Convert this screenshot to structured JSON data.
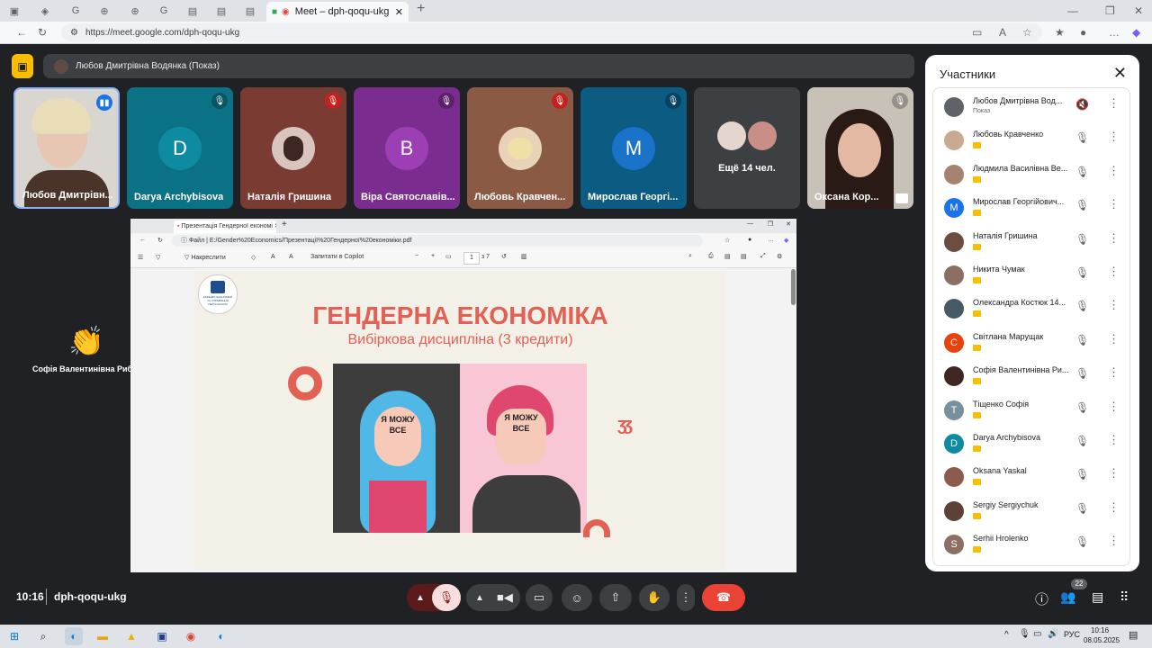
{
  "browser": {
    "active_tab_title": "Meet – dph-qoqu-ukg",
    "url": "https://meet.google.com/dph-qoqu-ukg"
  },
  "meet": {
    "presenter_label": "Любов Дмитрівна Водянка (Показ)",
    "tiles": [
      {
        "name": "Любов Дмитрівн...",
        "bg": "#cfcfcf"
      },
      {
        "name": "Darya Archybisova",
        "bg": "#0b7285",
        "initial": "D",
        "avatar_color": "#0e8ba0"
      },
      {
        "name": "Наталія Гришина",
        "bg": "#7a3b32"
      },
      {
        "name": "Віра Святославів...",
        "bg": "#7b2c8f",
        "initial": "В",
        "avatar_color": "#9c3fb5"
      },
      {
        "name": "Любовь Кравчен...",
        "bg": "#8a5a45"
      },
      {
        "name": "Мирослав Георгі...",
        "bg": "#0b5b82",
        "initial": "M",
        "avatar_color": "#1a73c8"
      },
      {
        "name": "Ещё 14 чел.",
        "bg": "#3c4043"
      },
      {
        "name": "Оксана Кор...",
        "bg": "#b9b3ab"
      }
    ],
    "reaction_name": "Софія Валентинівна Риб...",
    "meeting_time": "10:16",
    "meeting_code": "dph-qoqu-ukg",
    "participant_count": "22"
  },
  "pdf": {
    "tab_title": "Презентація Гендерної економі",
    "file_label": "Файл",
    "path": "E:/Gender%20Economics/Презентації%20Гендерної%20економіки.pdf",
    "draw_label": "Накреслити",
    "copilot_label": "Запитати в Copilot",
    "page_num": "1",
    "page_total": "з 7",
    "logo_text": "КАФЕДРА ЕКОНОМІКИ ТА УПРАВЛІННЯ ПЕРСОНАЛОМ",
    "slide_title": "ГЕНДЕРНА ЕКОНОМІКА",
    "slide_subtitle": "Вибіркова дисципліна (3 кредити)",
    "poster_text": "Я МОЖУ ВСЕ"
  },
  "panel": {
    "title": "Участники",
    "participants": [
      {
        "name": "Любов Дмитрівна Вод...",
        "sub": "Показ",
        "color": "#5f6368"
      },
      {
        "name": "Любовь Кравченко",
        "color": "#c9a98f"
      },
      {
        "name": "Людмила Василівна Ве...",
        "color": "#a6836e"
      },
      {
        "name": "Мирослав Георгійович...",
        "initial": "M",
        "color": "#1a73e8"
      },
      {
        "name": "Наталія Гришина",
        "color": "#6d4c41"
      },
      {
        "name": "Никита Чумак",
        "color": "#8d6e63"
      },
      {
        "name": "Олександра Костюк 14...",
        "color": "#455a64"
      },
      {
        "name": "Світлана Марущак",
        "initial": "С",
        "color": "#e8430e"
      },
      {
        "name": "Софія Валентинівна Ри...",
        "color": "#3e2723"
      },
      {
        "name": "Тіщенко Софія",
        "initial": "Т",
        "color": "#78909c"
      },
      {
        "name": "Darya Archybisova",
        "initial": "D",
        "color": "#0e8ba0"
      },
      {
        "name": "Oksana Yaskal",
        "color": "#8d5b4c"
      },
      {
        "name": "Sergiy Sergiychuk",
        "color": "#5d4037"
      },
      {
        "name": "Serhii Hrolenko",
        "initial": "S",
        "color": "#8d6e63"
      }
    ]
  },
  "taskbar": {
    "lang": "РУС",
    "time": "10:16",
    "date": "08.05.2025"
  },
  "colors": {
    "accent_yellow": "#fbbc04",
    "end_call": "#ea4335",
    "slide_red": "#e36055"
  }
}
